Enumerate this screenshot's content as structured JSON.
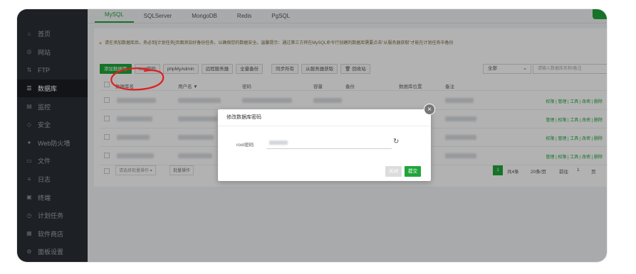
{
  "sidebar": {
    "items": [
      {
        "label": "首页",
        "icon": "home-icon"
      },
      {
        "label": "网站",
        "icon": "globe-icon"
      },
      {
        "label": "FTP",
        "icon": "ftp-icon"
      },
      {
        "label": "数据库",
        "icon": "database-icon",
        "active": true
      },
      {
        "label": "监控",
        "icon": "monitor-icon"
      },
      {
        "label": "安全",
        "icon": "shield-icon"
      },
      {
        "label": "Web防火墙",
        "icon": "firewall-icon"
      },
      {
        "label": "文件",
        "icon": "folder-icon"
      },
      {
        "label": "日志",
        "icon": "log-icon"
      },
      {
        "label": "终端",
        "icon": "terminal-icon"
      },
      {
        "label": "计划任务",
        "icon": "schedule-icon"
      },
      {
        "label": "软件商店",
        "icon": "store-icon"
      },
      {
        "label": "面板设置",
        "icon": "settings-icon"
      }
    ]
  },
  "tabs": [
    "MySQL",
    "SQLServer",
    "MongoDB",
    "Redis",
    "PgSQL"
  ],
  "warning": "请在添加数据库后，务必到[计划任务]页面添加好备份任务，以确保您的数据安全。温馨提示：通过第三方将在MySQL命令行创建的数据库需要点击\"从服务器获取\"才能在计划任务中备份",
  "toolbar": {
    "add": "添加数据库",
    "root_password": "root密码",
    "phpmyadmin": "phpMyAdmin",
    "remote_server": "远程服务器",
    "backup_all": "全量备份",
    "sync_all": "同步所有",
    "get_from_server": "从服务器获取",
    "recycle": "回收站"
  },
  "filter": {
    "selected": "全部"
  },
  "search": {
    "placeholder": "请输入数据库名称/备注"
  },
  "table": {
    "headers": {
      "name": "数据库名",
      "user": "用户名 ▼",
      "password": "密码",
      "capacity": "容量",
      "backup": "备份",
      "location": "数据库位置",
      "remark": "备注"
    },
    "rows": [
      {
        "actions": "权限 | 管理 | 工具 | 改密 | 删除"
      },
      {
        "actions": "管理 | 权限 | 工具 | 改密 | 删除"
      },
      {
        "actions": "权限 | 管理 | 工具 | 改密 | 删除"
      },
      {
        "actions": "管理 | 权限 | 工具 | 改密 | 删除"
      }
    ]
  },
  "pager": {
    "batch": "请选择批量操作",
    "batch_btn": "批量操作",
    "page": "1",
    "total": "共4条",
    "per_page": "20条/页",
    "goto": "前往",
    "goto_page": "1",
    "page_unit": "页"
  },
  "dialog": {
    "title": "修改数据库密码",
    "label": "root密码",
    "close": "×",
    "refresh": "↻",
    "cancel": "关闭",
    "submit": "提交"
  },
  "colors": {
    "accent": "#20a53a",
    "sidebar": "#2a2e34",
    "annotation": "#e02020"
  }
}
